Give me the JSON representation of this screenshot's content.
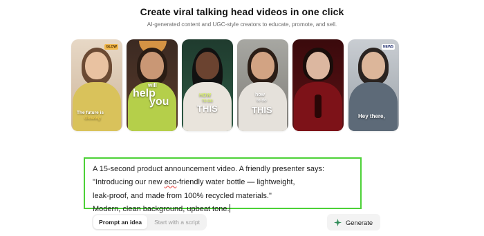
{
  "header": {
    "title": "Create viral talking head videos in one click",
    "subtitle": "AI-generated content and UGC-style creators to educate, promote, and sell."
  },
  "cards": [
    {
      "caption": "The future is",
      "caption2": "Glowing",
      "badge": "GLOW"
    },
    {
      "caption": "will",
      "caption2": "help",
      "caption3": "you"
    },
    {
      "caption": "HOW",
      "caption2": "TO DO",
      "caption3": "THIS"
    },
    {
      "caption": "how",
      "caption2": "to do",
      "caption3": "THIS"
    },
    {
      "caption": ""
    },
    {
      "caption": "Hey there,",
      "badge": "NEWS"
    }
  ],
  "prompt": {
    "line1": "A 15-second product announcement video. A friendly presenter says:",
    "line2_a": "\"Introducing our new ",
    "line2_spell": "eco",
    "line2_b": "-friendly water bottle — lightweight,",
    "line3": "leak-proof, and made from 100% recycled materials.\"",
    "line4": "Modern, clean background, upbeat tone."
  },
  "tabs": {
    "prompt_idea": "Prompt an idea",
    "with_script": "Start with a script"
  },
  "actions": {
    "generate": "Generate"
  },
  "colors": {
    "editor_border": "#4cd137",
    "spark": "#2e8b57"
  }
}
